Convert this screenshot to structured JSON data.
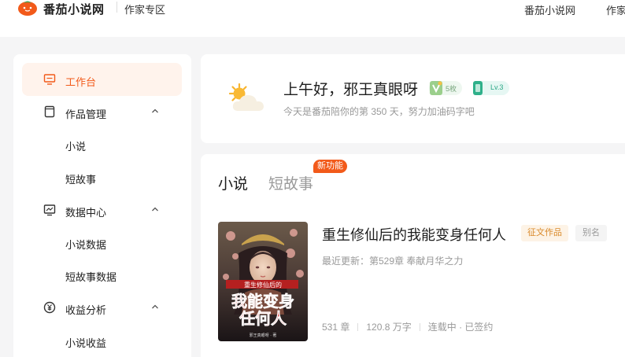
{
  "header": {
    "logo_text": "番茄小说网",
    "author_zone": "作家专区",
    "nav_links": [
      "番茄小说网",
      "作家"
    ]
  },
  "sidebar": {
    "items": [
      {
        "label": "工作台",
        "icon": "monitor-icon",
        "active": true
      },
      {
        "label": "作品管理",
        "icon": "document-icon"
      },
      {
        "label": "小说"
      },
      {
        "label": "短故事"
      },
      {
        "label": "数据中心",
        "icon": "chart-icon"
      },
      {
        "label": "小说数据"
      },
      {
        "label": "短故事数据"
      },
      {
        "label": "收益分析",
        "icon": "yuan-icon"
      },
      {
        "label": "小说收益"
      }
    ]
  },
  "greeting": {
    "title": "上午好，邪王真眼呀",
    "likes_badge": "5枚",
    "level_badge": "Lv.3",
    "subtitle": "今天是番茄陪你的第 350 天，努力加油码字吧"
  },
  "works": {
    "tabs": [
      "小说",
      "短故事"
    ],
    "new_badge": "新功能",
    "book": {
      "title": "重生修仙后的我能变身任何人",
      "tag_contest": "征文作品",
      "tag_alias": "别名",
      "latest": "最近更新：第529章 奉献月华之力",
      "chapters": "531 章",
      "words": "120.8 万字",
      "status": "连载中 · 已签约",
      "cover_small_title": "重生修仙后的",
      "cover_big_line1": "我能变身",
      "cover_big_line2": "任何人",
      "cover_author": "邪王真眼呀 · 著"
    }
  },
  "colors": {
    "accent": "#f25a1a",
    "active_bg": "#fff3ec",
    "page_bg": "#f5f5f6"
  }
}
